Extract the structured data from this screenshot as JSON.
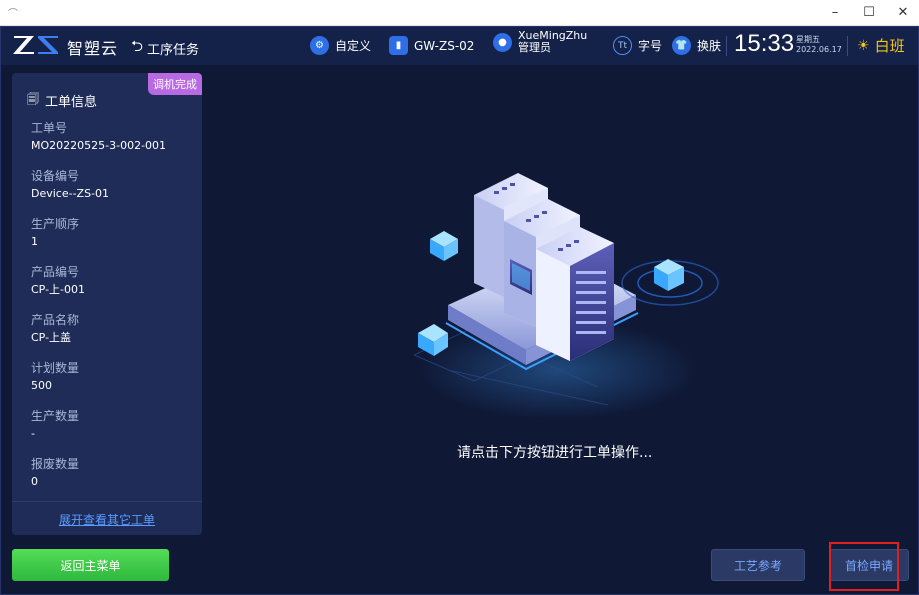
{
  "window": {
    "app_glyph": "⌒",
    "minimize": "–",
    "maximize": "☐",
    "close": "✕"
  },
  "header": {
    "brand": "智塑云",
    "back_label": "工序任务",
    "custom_label": "自定义",
    "station_label": "GW-ZS-02",
    "user_name": "XueMingZhu",
    "user_role": "管理员",
    "font_label": "字号",
    "skin_label": "换肤",
    "time": "15:33",
    "weekday": "星期五",
    "date": "2022.06.17",
    "shift": "白班",
    "icons": {
      "logo": "zs-logo-icon",
      "back": "back-cycle-icon",
      "custom": "gear-icon",
      "station": "station-icon",
      "user": "user-icon",
      "font": "font-size-icon",
      "skin": "tshirt-icon",
      "shift": "sun-icon"
    },
    "colors": {
      "accent": "#2e6ee6",
      "shift": "#f5c518"
    }
  },
  "panel": {
    "badge": "调机完成",
    "title": "工单信息",
    "fields": [
      {
        "label": "工单号",
        "value": "MO20220525-3-002-001"
      },
      {
        "label": "设备编号",
        "value": "Device--ZS-01"
      },
      {
        "label": "生产顺序",
        "value": "1"
      },
      {
        "label": "产品编号",
        "value": "CP-上-001"
      },
      {
        "label": "产品名称",
        "value": "CP-上盖"
      },
      {
        "label": "计划数量",
        "value": "500"
      },
      {
        "label": "生产数量",
        "value": "-"
      },
      {
        "label": "报废数量",
        "value": "0"
      }
    ],
    "expand_link": "展开查看其它工单",
    "colors": {
      "badge": "#b86ae3",
      "link": "#5a9bff"
    }
  },
  "main": {
    "prompt": "请点击下方按钮进行工单操作..."
  },
  "footer": {
    "home_button": "返回主菜单",
    "craft_button": "工艺参考",
    "first_check_button": "首检申请",
    "colors": {
      "home": "#3fc948",
      "highlight": "#e01f1f"
    }
  }
}
